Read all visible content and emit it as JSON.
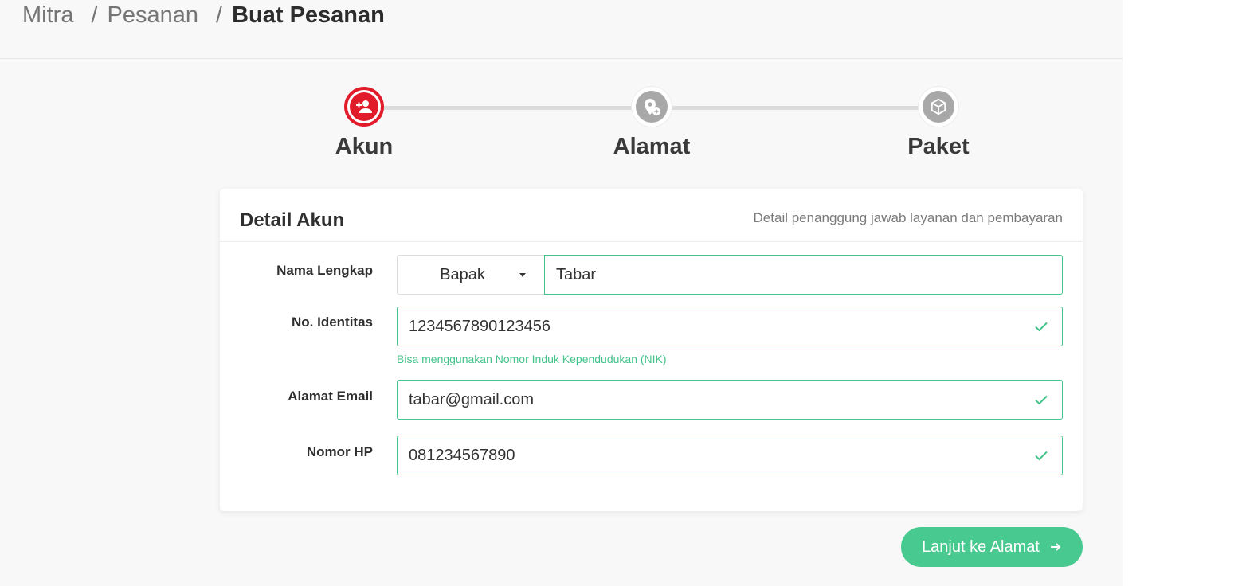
{
  "breadcrumb": {
    "items": [
      "Mitra",
      "Pesanan",
      "Buat Pesanan"
    ],
    "separator": "/"
  },
  "stepper": {
    "steps": [
      {
        "label": "Akun",
        "icon": "user-plus-icon",
        "state": "active"
      },
      {
        "label": "Alamat",
        "icon": "map-pin-plus-icon",
        "state": "inactive"
      },
      {
        "label": "Paket",
        "icon": "package-icon",
        "state": "inactive"
      }
    ]
  },
  "card": {
    "title": "Detail Akun",
    "subtitle": "Detail penanggung jawab layanan dan pembayaran"
  },
  "form": {
    "name": {
      "label": "Nama Lengkap",
      "salutation": "Bapak",
      "value": "Tabar"
    },
    "identity": {
      "label": "No. Identitas",
      "value": "1234567890123456",
      "hint": "Bisa menggunakan Nomor Induk Kependudukan (NIK)"
    },
    "email": {
      "label": "Alamat Email",
      "value": "tabar@gmail.com"
    },
    "phone": {
      "label": "Nomor HP",
      "value": "081234567890"
    }
  },
  "actions": {
    "next_label": "Lanjut ke Alamat"
  },
  "colors": {
    "accent_red": "#e21b2b",
    "accent_green": "#48c98f",
    "inactive_grey": "#a8a8a8"
  }
}
